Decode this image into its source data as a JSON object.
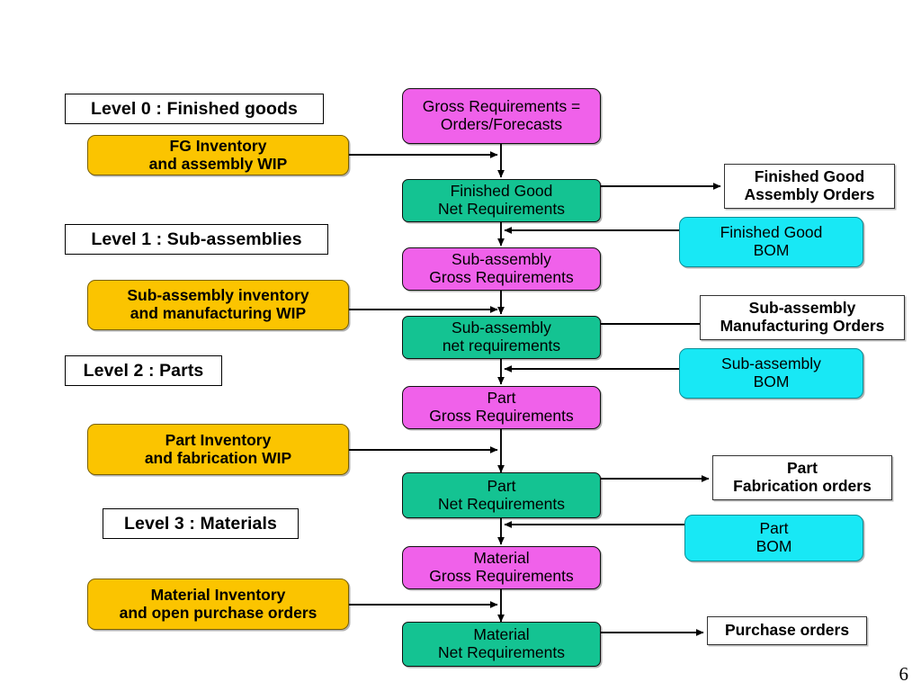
{
  "page": {
    "number": "6",
    "background": "#ffffff"
  },
  "colors": {
    "inventory_yellow": "#fbc400",
    "gross_pink": "#f061ea",
    "net_green": "#14c392",
    "bom_cyan": "#18e8f5",
    "order_white": "#ffffff",
    "outline_black": "#000000"
  },
  "levels": [
    {
      "label": "Level 0 : Finished goods"
    },
    {
      "label": "Level 1 : Sub-assemblies"
    },
    {
      "label": "Level 2 : Parts"
    },
    {
      "label": "Level 3 : Materials"
    }
  ],
  "inventory_boxes": [
    {
      "line1": "FG Inventory",
      "line2": "and assembly WIP"
    },
    {
      "line1": "Sub-assembly inventory",
      "line2": "and manufacturing WIP"
    },
    {
      "line1": "Part Inventory",
      "line2": "and fabrication WIP"
    },
    {
      "line1": "Material Inventory",
      "line2": "and open purchase orders"
    }
  ],
  "gross_boxes": [
    {
      "line1": "Gross Requirements =",
      "line2": "Orders/Forecasts"
    },
    {
      "line1": "Sub-assembly",
      "line2": "Gross Requirements"
    },
    {
      "line1": "Part",
      "line2": "Gross Requirements"
    },
    {
      "line1": "Material",
      "line2": "Gross Requirements"
    }
  ],
  "net_boxes": [
    {
      "line1": "Finished Good",
      "line2": "Net Requirements"
    },
    {
      "line1": "Sub-assembly",
      "line2": "net requirements"
    },
    {
      "line1": "Part",
      "line2": "Net Requirements"
    },
    {
      "line1": "Material",
      "line2": "Net Requirements"
    }
  ],
  "order_boxes": [
    {
      "line1": "Finished Good",
      "line2": "Assembly Orders"
    },
    {
      "line1": "Sub-assembly",
      "line2": "Manufacturing Orders"
    },
    {
      "line1": "Part",
      "line2": "Fabrication orders"
    },
    {
      "line1": "Purchase orders",
      "line2": ""
    }
  ],
  "bom_boxes": [
    {
      "line1": "Finished Good",
      "line2": "BOM"
    },
    {
      "line1": "Sub-assembly",
      "line2": "BOM"
    },
    {
      "line1": "Part",
      "line2": "BOM"
    }
  ]
}
